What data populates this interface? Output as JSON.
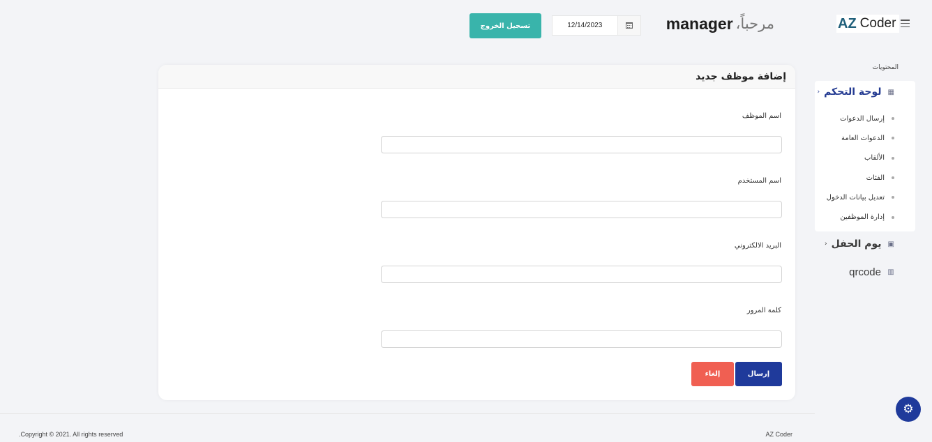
{
  "header": {
    "logo_az": "AZ",
    "logo_coder": "Coder",
    "welcome_text": "مرحباً،",
    "username": "manager",
    "date_value": "12/14/2023",
    "logout_label": "تسجيل الخروج"
  },
  "sidebar": {
    "section_title": "المحتويات",
    "dashboard": {
      "label": "لوحة التحكم",
      "icon": "grid-icon"
    },
    "sub_items": [
      {
        "label": "إرسال الدعوات"
      },
      {
        "label": "الدعوات العامة"
      },
      {
        "label": "الألقاب"
      },
      {
        "label": "الفئات"
      },
      {
        "label": "تعديل بيانات الدخول"
      },
      {
        "label": "إدارة الموظفين"
      }
    ],
    "party_day": {
      "label": "يوم الحفل",
      "icon": "calendar-icon"
    },
    "qrcode": {
      "label": "qrcode",
      "icon": "barcode-icon"
    }
  },
  "form": {
    "title": "إضافة موظف جديد",
    "fields": [
      {
        "label": "اسم الموظف",
        "value": ""
      },
      {
        "label": "اسم المستخدم",
        "value": ""
      },
      {
        "label": "البريد الالكتروني",
        "value": ""
      },
      {
        "label": "كلمة المرور",
        "value": ""
      }
    ],
    "submit_label": "إرسال",
    "cancel_label": "إلغاء"
  },
  "footer": {
    "copyright": ".Copyright © 2021. All rights reserved",
    "brand": "AZ Coder"
  },
  "colors": {
    "primary": "#1f3a9b",
    "teal": "#39b4ab",
    "danger": "#f05f52",
    "background": "#f3f4f7"
  }
}
